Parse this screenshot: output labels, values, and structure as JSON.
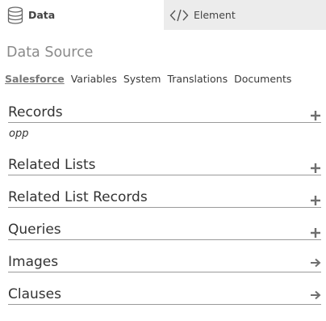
{
  "tabs": {
    "data": "Data",
    "element": "Element"
  },
  "data_source": {
    "title": "Data Source",
    "subtabs": [
      "Salesforce",
      "Variables",
      "System",
      "Translations",
      "Documents"
    ],
    "active_subtab": "Salesforce"
  },
  "sections": [
    {
      "label": "Records",
      "icon": "plus-icon",
      "items": [
        "opp"
      ]
    },
    {
      "label": "Related Lists",
      "icon": "plus-icon"
    },
    {
      "label": "Related List Records",
      "icon": "plus-icon"
    },
    {
      "label": "Queries",
      "icon": "plus-icon"
    },
    {
      "label": "Images",
      "icon": "arrow-right-icon"
    },
    {
      "label": "Clauses",
      "icon": "arrow-right-icon"
    }
  ],
  "colors": {
    "inactive_tab_bg": "#ececec",
    "divider": "#9a9a9a",
    "muted_title": "#8a8a8a",
    "icon": "#6f6f6f"
  }
}
